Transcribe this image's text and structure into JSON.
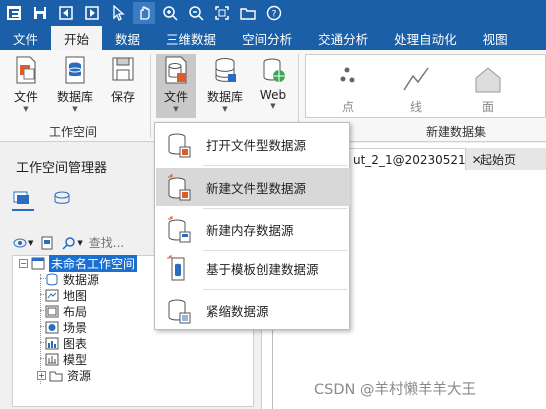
{
  "titlebar": {
    "icons": [
      "app-logo-icon",
      "save-icon",
      "back-icon",
      "forward-icon",
      "pointer-icon",
      "pan-hand-icon",
      "zoom-in-icon",
      "zoom-out-icon",
      "full-extent-icon",
      "folder-icon",
      "help-icon"
    ]
  },
  "tabs": [
    "文件",
    "开始",
    "数据",
    "三维数据",
    "空间分析",
    "交通分析",
    "处理自动化",
    "视图"
  ],
  "ribbon": {
    "workspace_buttons": [
      {
        "label": "文件",
        "icon": "file-icon"
      },
      {
        "label": "数据库",
        "icon": "database-icon"
      },
      {
        "label": "保存",
        "icon": "save-disk-icon"
      }
    ],
    "workspace_group_label": "工作空间",
    "datasource_buttons": [
      {
        "label": "文件",
        "icon": "file-datasource-icon"
      },
      {
        "label": "数据库",
        "icon": "database-datasource-icon"
      },
      {
        "label": "Web",
        "icon": "web-datasource-icon"
      }
    ],
    "dataset_gallery": [
      {
        "label": "点",
        "icon": "point-dataset-icon"
      },
      {
        "label": "线",
        "icon": "line-dataset-icon"
      },
      {
        "label": "面",
        "icon": "region-dataset-icon"
      }
    ],
    "dataset_group_label": "新建数据集"
  },
  "workspace_panel": {
    "title": "工作空间管理器",
    "search_placeholder": "查找...",
    "tree": {
      "root": "未命名工作空间",
      "children": [
        "数据源",
        "地图",
        "布局",
        "场景",
        "图表",
        "模型",
        "资源"
      ]
    }
  },
  "document_tabs": [
    {
      "label": "ut_2_1@20230521",
      "active": true
    },
    {
      "label": "起始页",
      "active": false
    }
  ],
  "dropdown_menu": {
    "items": [
      {
        "label": "打开文件型数据源",
        "icon": "open-file-datasource-icon"
      },
      {
        "label": "新建文件型数据源",
        "icon": "new-file-datasource-icon"
      },
      {
        "label": "新建内存数据源",
        "icon": "new-memory-datasource-icon"
      },
      {
        "label": "基于模板创建数据源",
        "icon": "template-datasource-icon"
      },
      {
        "label": "紧缩数据源",
        "icon": "compact-datasource-icon"
      }
    ],
    "hovered_index": 1
  },
  "watermark": "CSDN @羊村懒羊羊大王",
  "colors": {
    "titlebar": "#1a5fa8",
    "active_tab": "#f4f4f4",
    "selection": "#1a6fd0",
    "menu_hover": "#d8d8d8"
  }
}
